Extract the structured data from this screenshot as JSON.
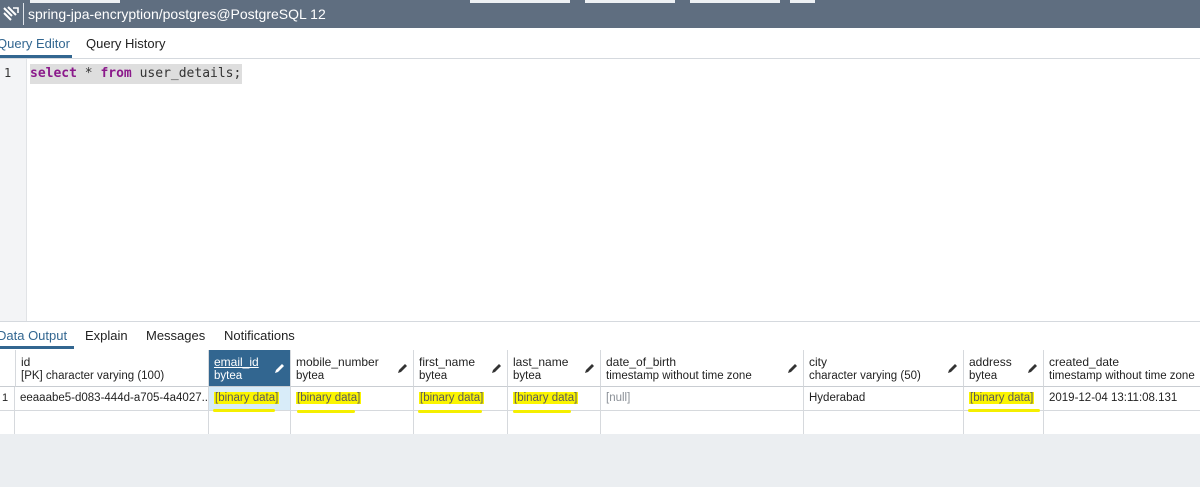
{
  "window": {
    "title": "spring-jpa-encryption/postgres@PostgreSQL 12",
    "titlebar_color": "#5f6e80"
  },
  "editor_tabs": [
    {
      "label": "Query Editor",
      "active": true
    },
    {
      "label": "Query History",
      "active": false
    }
  ],
  "editor": {
    "line_number": "1",
    "tokens": {
      "kw1": "select",
      "star": " * ",
      "kw2": "from",
      "rest": " user_details;"
    }
  },
  "output_tabs": [
    {
      "label": "Data Output",
      "active": true
    },
    {
      "label": "Explain",
      "active": false
    },
    {
      "label": "Messages",
      "active": false
    },
    {
      "label": "Notifications",
      "active": false
    }
  ],
  "columns": [
    {
      "name": "id",
      "type": "[PK] character varying (100)",
      "editable": false
    },
    {
      "name": "email_id",
      "type": "bytea",
      "editable": true,
      "selected": true
    },
    {
      "name": "mobile_number",
      "type": "bytea",
      "editable": true
    },
    {
      "name": "first_name",
      "type": "bytea",
      "editable": true
    },
    {
      "name": "last_name",
      "type": "bytea",
      "editable": true
    },
    {
      "name": "date_of_birth",
      "type": "timestamp without time zone",
      "editable": true
    },
    {
      "name": "city",
      "type": "character varying (50)",
      "editable": true
    },
    {
      "name": "address",
      "type": "bytea",
      "editable": true
    },
    {
      "name": "created_date",
      "type": "timestamp without time zone",
      "editable": false
    }
  ],
  "rows": [
    {
      "row_number": "1",
      "cells": [
        "eeaaabe5-d083-444d-a705-4a4027...",
        "[binary data]",
        "[binary data]",
        "[binary data]",
        "[binary data]",
        "[null]",
        "Hyderabad",
        "[binary data]",
        "2019-12-04 13:11:08.131"
      ]
    }
  ],
  "colors": {
    "accent": "#326690",
    "highlight": "#fbf500",
    "keyword": "#8b1a8b"
  }
}
